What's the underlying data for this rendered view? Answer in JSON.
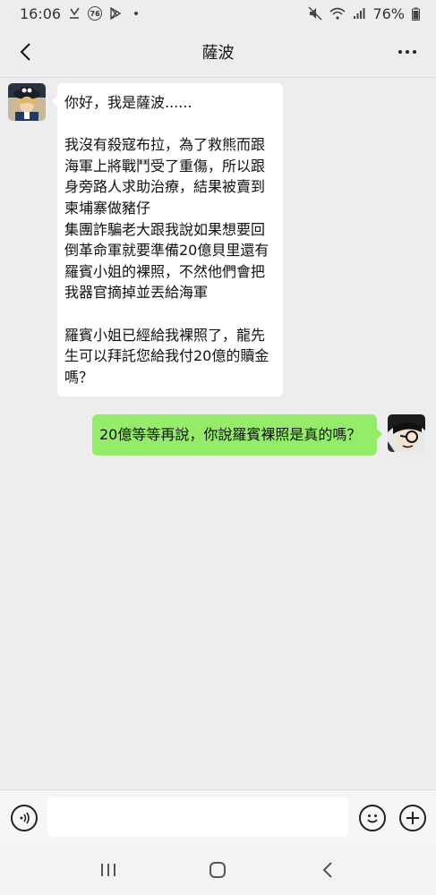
{
  "status_bar": {
    "time": "16:06",
    "notification_badge": "76",
    "battery": "76%"
  },
  "header": {
    "title": "薩波"
  },
  "messages": [
    {
      "sender": "left",
      "lines": [
        "你好，我是薩波......",
        "",
        "我沒有殺寇布拉，為了救熊而跟",
        "海軍上將戰鬥受了重傷，所以跟",
        "身旁路人求助治療，結果被賣到",
        "柬埔寨做豬仔",
        "集團詐騙老大跟我說如果想要回",
        "倒革命軍就要準備20億貝里還有",
        "羅賓小姐的裸照，不然他們會把",
        "我器官摘掉並丟給海軍",
        "",
        "羅賓小姐已經給我裸照了，龍先",
        "生可以拜託您給我付20億的贖金",
        "嗎？"
      ]
    },
    {
      "sender": "right",
      "text": "20億等等再說，你說羅賓裸照是真的嗎？"
    }
  ],
  "input": {
    "value": ""
  },
  "colors": {
    "background": "#ededed",
    "bubble_self": "#95ec69",
    "bubble_other": "#ffffff"
  }
}
